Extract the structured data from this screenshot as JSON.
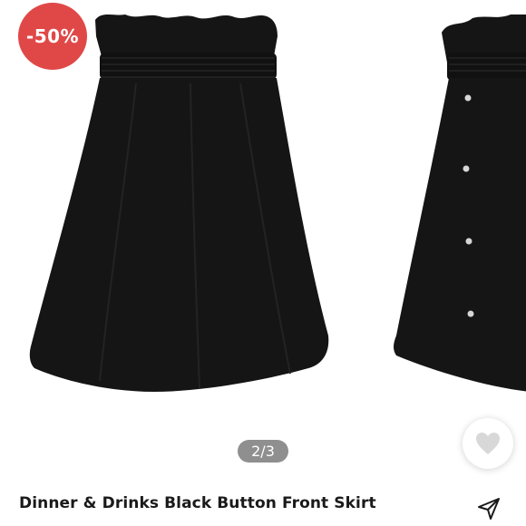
{
  "product": {
    "title": "Dinner & Drinks Black Button Front Skirt",
    "discount_badge": "-50%",
    "image_pager": "2/3"
  },
  "colors": {
    "badge": "#e04848",
    "pager_bg": "#8f8f8f",
    "skirt": "#141414",
    "heart": "#d8d8d8"
  },
  "icons": {
    "wishlist": "heart-icon",
    "share": "send-icon"
  }
}
